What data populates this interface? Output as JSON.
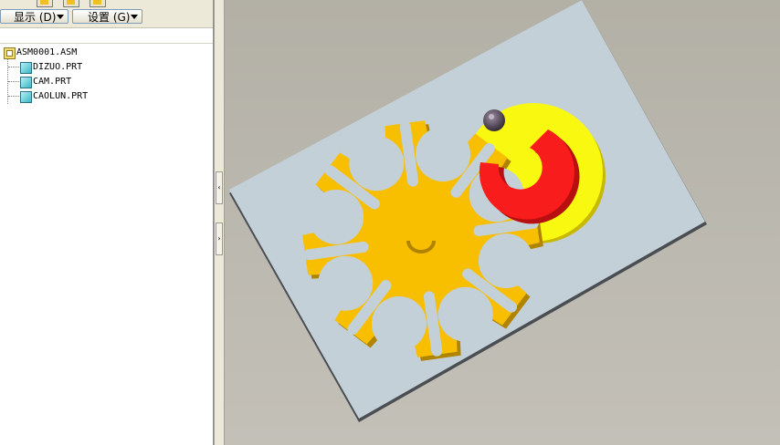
{
  "toolbar": {
    "display_label": "显示 (D)",
    "settings_label": "设置 (G)"
  },
  "tree": {
    "root": {
      "label": "ASM0001.ASM",
      "icon": "assembly-icon"
    },
    "children": [
      {
        "label": "DIZUO.PRT",
        "icon": "part-icon"
      },
      {
        "label": "CAM.PRT",
        "icon": "part-icon"
      },
      {
        "label": "CAOLUN.PRT",
        "icon": "part-icon"
      }
    ]
  },
  "colors": {
    "plate": "#c3d0d8",
    "plate_edge": "#4a4e52",
    "geneva_wheel": "#f8be00",
    "geneva_shadow": "#b08400",
    "cam_disk": "#f8f810",
    "cam_shadow": "#c8b800",
    "cam_insert": "#f81c1c",
    "pin": "#4a3c48"
  }
}
